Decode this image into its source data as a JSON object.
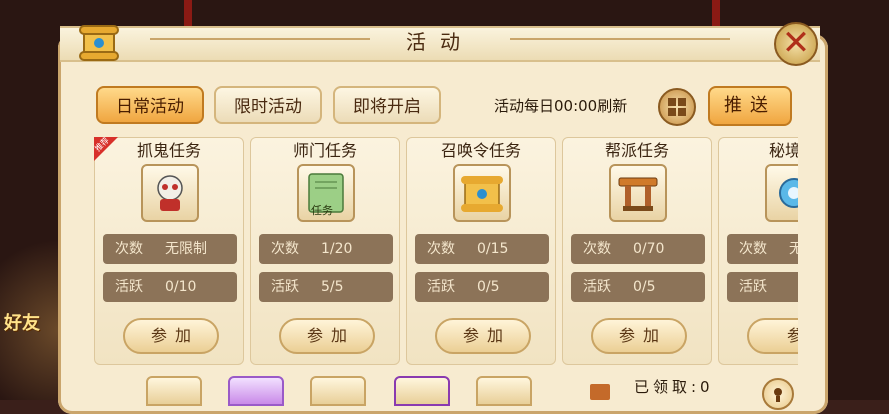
{
  "window": {
    "title": "活动"
  },
  "tabs": [
    {
      "label": "日常活动",
      "active": true
    },
    {
      "label": "限时活动",
      "active": false
    },
    {
      "label": "即将开启",
      "active": false
    }
  ],
  "refresh_note": "活动每日00:00刷新",
  "push_button": "推送",
  "side_label": "好友",
  "cards": [
    {
      "title": "抓鬼任务",
      "icon": "ghost-skull-icon",
      "badge": "推荐",
      "count_label": "次数",
      "count": "无限制",
      "active_label": "活跃",
      "active": "0/10",
      "join": "参加"
    },
    {
      "title": "师门任务",
      "icon": "quest-scroll-icon",
      "icon_text": "任务",
      "count_label": "次数",
      "count": "1/20",
      "active_label": "活跃",
      "active": "5/5",
      "join": "参加"
    },
    {
      "title": "召唤令任务",
      "icon": "summon-scroll-icon",
      "count_label": "次数",
      "count": "0/15",
      "active_label": "活跃",
      "active": "0/5",
      "join": "参加"
    },
    {
      "title": "帮派任务",
      "icon": "guild-gate-icon",
      "count_label": "次数",
      "count": "0/70",
      "active_label": "活跃",
      "active": "0/5",
      "join": "参加"
    },
    {
      "title": "秘境降",
      "icon": "secret-realm-icon",
      "count_label": "次数",
      "count": "无",
      "active_label": "活跃",
      "active": "",
      "join": "参"
    }
  ],
  "bottom": {
    "claimed_label": "已领取:0"
  },
  "colors": {
    "accent": "#f0a640",
    "panel": "#f7ebd0",
    "stat_bg": "#8c7358"
  }
}
